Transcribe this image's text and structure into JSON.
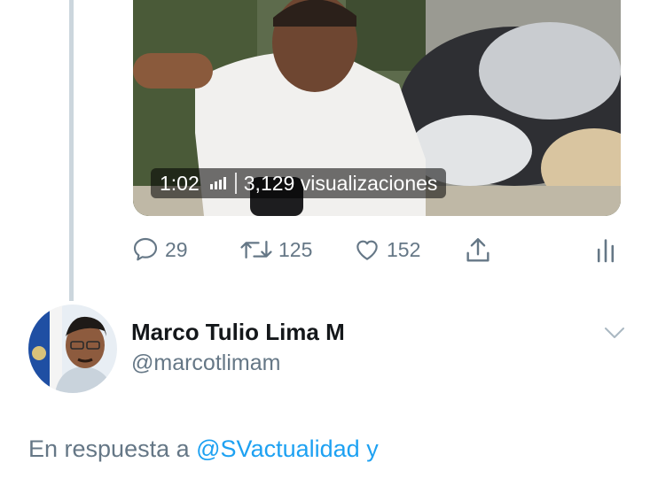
{
  "video": {
    "duration": "1:02",
    "views": "3,129 visualizaciones"
  },
  "actions": {
    "replies": "29",
    "retweets": "125",
    "likes": "152"
  },
  "user": {
    "display_name": "Marco Tulio Lima M",
    "handle": "@marcotlimam"
  },
  "reply": {
    "prefix": "En respuesta a",
    "mention": "@SVactualidad",
    "conjunction": "y"
  },
  "icons": {
    "reply": "comment-bubble-icon",
    "retweet": "retweet-icon",
    "like": "heart-icon",
    "share": "share-icon",
    "analytics": "analytics-icon",
    "caret": "chevron-down-icon",
    "volume": "volume-bars-icon"
  },
  "colors": {
    "link": "#1da1f2",
    "muted": "#657786",
    "text": "#14171a",
    "thread_line": "#ccd6dd"
  }
}
